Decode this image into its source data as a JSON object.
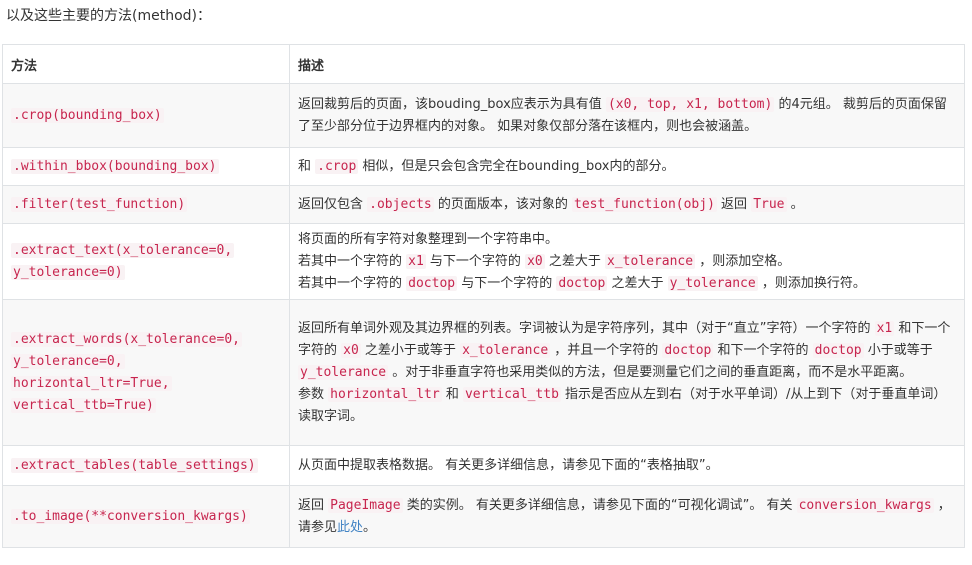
{
  "intro": "以及这些主要的方法(method)：",
  "table": {
    "headers": [
      "方法",
      "描述"
    ],
    "rows": [
      {
        "method": ".crop(bounding_box)",
        "desc": [
          {
            "t": "返回裁剪后的页面，该bouding_box应表示为具有值 "
          },
          {
            "c": "(x0, top, x1, bottom)"
          },
          {
            "t": " 的4元组。 裁剪后的页面保留了至少部分位于边界框内的对象。 如果对象仅部分落在该框内，则也会被涵盖。"
          }
        ]
      },
      {
        "method": ".within_bbox(bounding_box)",
        "desc": [
          {
            "t": "和 "
          },
          {
            "c": ".crop"
          },
          {
            "t": " 相似，但是只会包含完全在bounding_box内的部分。"
          }
        ]
      },
      {
        "method": ".filter(test_function)",
        "desc": [
          {
            "t": "返回仅包含 "
          },
          {
            "c": ".objects"
          },
          {
            "t": " 的页面版本，该对象的 "
          },
          {
            "c": "test_function(obj)"
          },
          {
            "t": " 返回 "
          },
          {
            "c": "True"
          },
          {
            "t": " 。"
          }
        ]
      },
      {
        "method_lines": [
          ".extract_text(x_tolerance=0,",
          "y_tolerance=0)"
        ],
        "desc_lines": [
          [
            {
              "t": "将页面的所有字符对象整理到一个字符串中。"
            }
          ],
          [
            {
              "t": "若其中一个字符的 "
            },
            {
              "c": "x1"
            },
            {
              "t": " 与下一个字符的 "
            },
            {
              "c": "x0"
            },
            {
              "t": " 之差大于 "
            },
            {
              "c": "x_tolerance"
            },
            {
              "t": " ，则添加空格。"
            }
          ],
          [
            {
              "t": "若其中一个字符的 "
            },
            {
              "c": "doctop"
            },
            {
              "t": " 与下一个字符的 "
            },
            {
              "c": "doctop"
            },
            {
              "t": " 之差大于 "
            },
            {
              "c": "y_tolerance"
            },
            {
              "t": " ，则添加换行符。"
            }
          ]
        ]
      },
      {
        "method_lines": [
          ".extract_words(x_tolerance=0,",
          "y_tolerance=0,",
          "horizontal_ltr=True,",
          "vertical_ttb=True)"
        ],
        "desc_lines": [
          [
            {
              "t": "返回所有单词外观及其边界框的列表。字词被认为是字符序列，其中（对于“直立”字符）一个字符的 "
            },
            {
              "c": "x1"
            },
            {
              "t": " 和下一个字符的 "
            },
            {
              "c": "x0"
            },
            {
              "t": " 之差小于或等于 "
            },
            {
              "c": "x_tolerance"
            },
            {
              "t": " ，并且一个字符的 "
            },
            {
              "c": "doctop"
            },
            {
              "t": " 和下一个字符的 "
            },
            {
              "c": "doctop"
            },
            {
              "t": " 小于或等于 "
            },
            {
              "c": "y_tolerance"
            },
            {
              "t": " 。对于非垂直字符也采用类似的方法，但是要测量它们之间的垂直距离，而不是水平距离。"
            }
          ],
          [
            {
              "t": "参数 "
            },
            {
              "c": "horizontal_ltr"
            },
            {
              "t": " 和 "
            },
            {
              "c": "vertical_ttb"
            },
            {
              "t": " 指示是否应从左到右（对于水平单词）/从上到下（对于垂直单词）读取字词。"
            }
          ]
        ]
      },
      {
        "method": ".extract_tables(table_settings)",
        "desc": [
          {
            "t": "从页面中提取表格数据。 有关更多详细信息，请参见下面的“表格抽取”。"
          }
        ]
      },
      {
        "method": ".to_image(**conversion_kwargs)",
        "desc": [
          {
            "t": "返回 "
          },
          {
            "c": "PageImage"
          },
          {
            "t": " 类的实例。 有关更多详细信息，请参见下面的“可视化调试”。 有关 "
          },
          {
            "c": "conversion_kwargs"
          },
          {
            "t": " ，请参见"
          },
          {
            "l": "此处"
          },
          {
            "t": "。"
          }
        ]
      }
    ]
  }
}
